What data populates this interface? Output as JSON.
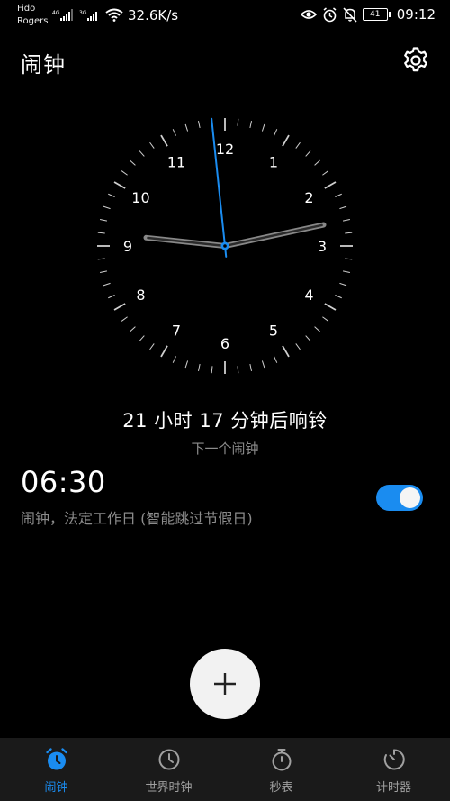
{
  "status_bar": {
    "carrier_line1": "Fido",
    "carrier_line2": "Rogers",
    "signal1_label": "4G",
    "signal2_label": "3G",
    "net_speed": "32.6K/s",
    "battery": "41",
    "time": "09:12"
  },
  "header": {
    "title": "闹钟"
  },
  "clock": {
    "numbers": [
      "12",
      "1",
      "2",
      "3",
      "4",
      "5",
      "6",
      "7",
      "8",
      "9",
      "10",
      "11"
    ],
    "hour": 9,
    "minute": 12,
    "second": 59,
    "second_hand_color": "#1a8cf0"
  },
  "next_alarm": {
    "countdown": "21 小时 17 分钟后响铃",
    "label": "下一个闹钟"
  },
  "alarms": [
    {
      "time": "06:30",
      "description": "闹钟，法定工作日 (智能跳过节假日)",
      "enabled": true
    }
  ],
  "fab": {
    "icon": "plus-icon"
  },
  "bottom_nav": {
    "items": [
      {
        "label": "闹钟",
        "icon": "alarm-clock-icon",
        "active": true
      },
      {
        "label": "世界时钟",
        "icon": "world-clock-icon",
        "active": false
      },
      {
        "label": "秒表",
        "icon": "stopwatch-icon",
        "active": false
      },
      {
        "label": "计时器",
        "icon": "timer-icon",
        "active": false
      }
    ]
  },
  "colors": {
    "accent": "#1a8cf0",
    "background": "#000000",
    "nav_background": "#1a1a1a",
    "secondary_text": "#8c8c8c"
  }
}
